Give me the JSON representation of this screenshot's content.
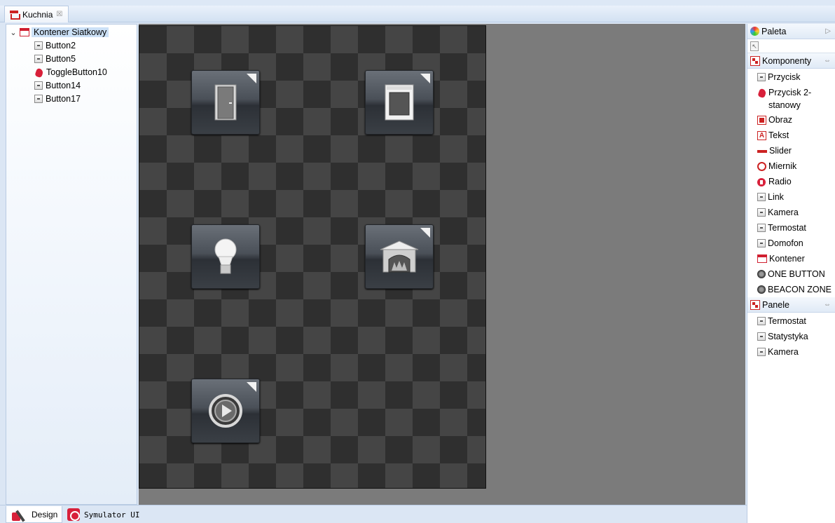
{
  "editor_tab": {
    "title": "Kuchnia",
    "close_glyph": "☒"
  },
  "tree": {
    "root_label": "Kontener Siatkowy",
    "items": [
      {
        "label": "Button2",
        "icon": "button-icon"
      },
      {
        "label": "Button5",
        "icon": "button-icon"
      },
      {
        "label": "ToggleButton10",
        "icon": "toggle-button-icon"
      },
      {
        "label": "Button14",
        "icon": "button-icon"
      },
      {
        "label": "Button17",
        "icon": "button-icon"
      }
    ]
  },
  "canvas": {
    "tiles": [
      {
        "name": "door",
        "icon": "door-icon"
      },
      {
        "name": "oven",
        "icon": "oven-icon"
      },
      {
        "name": "bulb",
        "icon": "light-bulb-icon"
      },
      {
        "name": "fireplace",
        "icon": "fireplace-icon"
      },
      {
        "name": "play",
        "icon": "play-icon"
      }
    ]
  },
  "palette": {
    "title": "Paleta",
    "sections": [
      {
        "title": "Komponenty",
        "items": [
          {
            "label": "Przycisk",
            "icon": "button-icon"
          },
          {
            "label": "Przycisk 2-stanowy",
            "icon": "toggle-button-icon"
          },
          {
            "label": "Obraz",
            "icon": "image-icon"
          },
          {
            "label": "Tekst",
            "icon": "text-icon"
          },
          {
            "label": "Slider",
            "icon": "slider-icon"
          },
          {
            "label": "Miernik",
            "icon": "gauge-icon"
          },
          {
            "label": "Radio",
            "icon": "radio-icon"
          },
          {
            "label": "Link",
            "icon": "button-icon"
          },
          {
            "label": "Kamera",
            "icon": "button-icon"
          },
          {
            "label": "Termostat",
            "icon": "button-icon"
          },
          {
            "label": "Domofon",
            "icon": "button-icon"
          },
          {
            "label": "Kontener",
            "icon": "container-icon"
          },
          {
            "label": "ONE BUTTON",
            "icon": "one-button-icon"
          },
          {
            "label": "BEACON ZONE",
            "icon": "beacon-zone-icon"
          }
        ]
      },
      {
        "title": "Panele",
        "items": [
          {
            "label": "Termostat",
            "icon": "button-icon"
          },
          {
            "label": "Statystyka",
            "icon": "button-icon"
          },
          {
            "label": "Kamera",
            "icon": "button-icon"
          }
        ]
      }
    ]
  },
  "bottom_tabs": {
    "design": "Design",
    "simulator": "Symulator UI"
  }
}
